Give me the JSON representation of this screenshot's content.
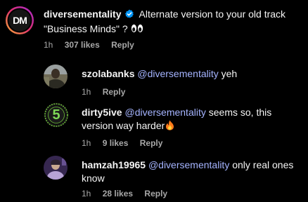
{
  "main_comment": {
    "username": "diversementality",
    "text_line1": "Alternate version to your old track",
    "text_line2": "\"Business Minds\" ?",
    "time": "1h",
    "likes": "307 likes",
    "reply_label": "Reply",
    "avatar_logo": "DM"
  },
  "replies": [
    {
      "username": "szolabanks",
      "mention": "@diversementality",
      "text": " yeh",
      "time": "1h",
      "likes": "",
      "reply_label": "Reply"
    },
    {
      "username": "dirty5ive",
      "mention": "@diversementality",
      "text_line1": " seems so, this",
      "text_line2": "version way harder",
      "time": "1h",
      "likes": "9 likes",
      "reply_label": "Reply",
      "avatar_glyph": "5"
    },
    {
      "username": "hamzah19965",
      "mention": "@diversementality",
      "text_line1": " only real ones",
      "text_line2": "know",
      "time": "1h",
      "likes": "28 likes",
      "reply_label": "Reply"
    }
  ],
  "colors": {
    "background": "#000000",
    "text": "#f5f5f5",
    "meta": "#a8a8a8",
    "mention": "#a5b4ff",
    "verified": "#0095f6"
  }
}
